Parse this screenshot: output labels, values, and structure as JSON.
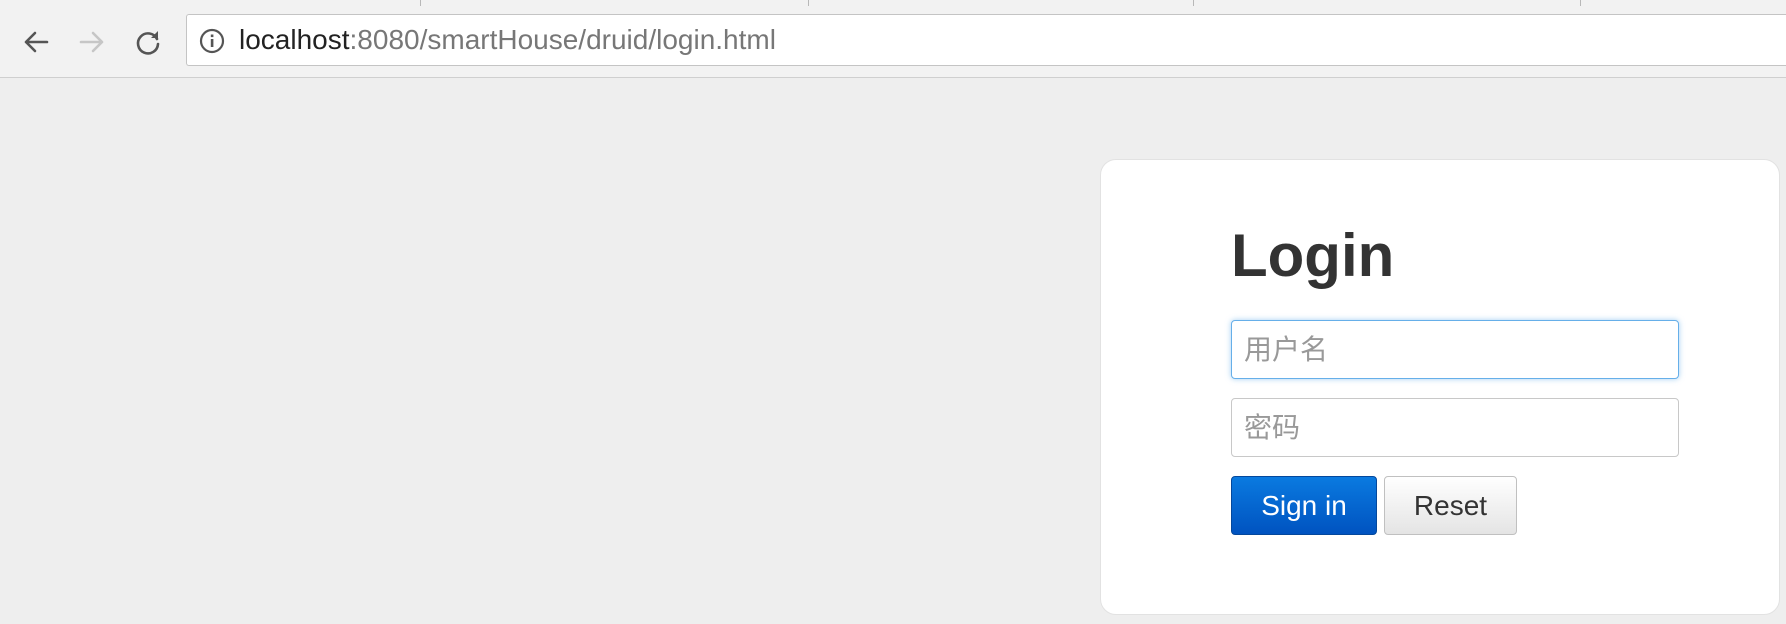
{
  "browser": {
    "url_host": "localhost",
    "url_path": ":8080/smartHouse/druid/login.html",
    "icons": {
      "back": "back-arrow-icon",
      "forward": "forward-arrow-icon",
      "reload": "reload-icon",
      "info": "info-icon"
    }
  },
  "login": {
    "title": "Login",
    "username_placeholder": "用户名",
    "password_placeholder": "密码",
    "signin_label": "Sign in",
    "reset_label": "Reset"
  },
  "colors": {
    "page_background": "#eeeeee",
    "primary_button": "#0062cc",
    "focus_border": "#66afe9"
  }
}
